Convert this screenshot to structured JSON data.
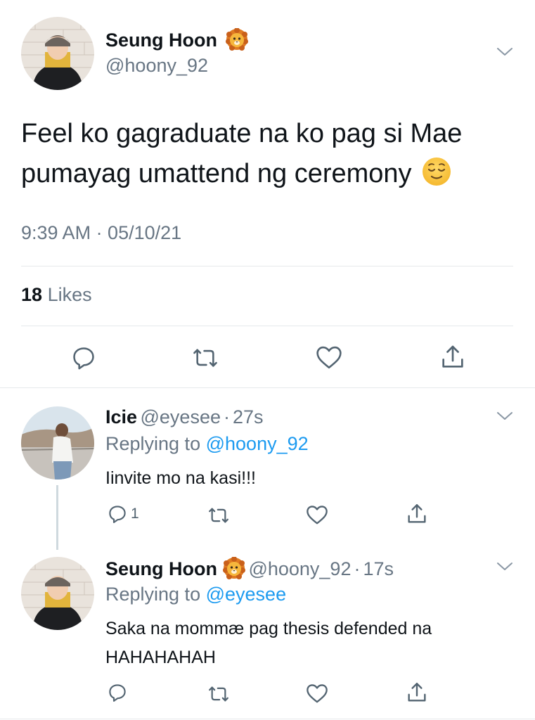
{
  "main_tweet": {
    "name": "Seung Hoon",
    "handle": "@hoony_92",
    "text_line1": "Feel ko gagraduate na ko pag si Mae",
    "text_line2": "pumayag umattend ng ceremony",
    "time": "9:39 AM · 05/10/21",
    "likes_count": "18",
    "likes_label": "Likes"
  },
  "replies": [
    {
      "name": "Icie",
      "handle": "@eyesee",
      "time": "27s",
      "replying_prefix": "Replying to",
      "replying_to": "@hoony_92",
      "text": "Iinvite mo na kasi!!!",
      "reply_count": "1"
    },
    {
      "name": "Seung Hoon",
      "handle": "@hoony_92",
      "time": "17s",
      "replying_prefix": "Replying to",
      "replying_to": "@eyesee",
      "text_line1": "Saka na mommæ pag thesis defended na",
      "text_line2": "HAHAHAHAH"
    }
  ],
  "separator": "·",
  "icons": [
    "chevron-down-icon",
    "lion-emoji-icon",
    "relieved-face-emoji-icon",
    "reply-icon",
    "retweet-icon",
    "like-icon",
    "share-icon"
  ],
  "colors": {
    "link": "#1d9bf0",
    "muted": "#687684",
    "divider": "#e6e9eb"
  }
}
